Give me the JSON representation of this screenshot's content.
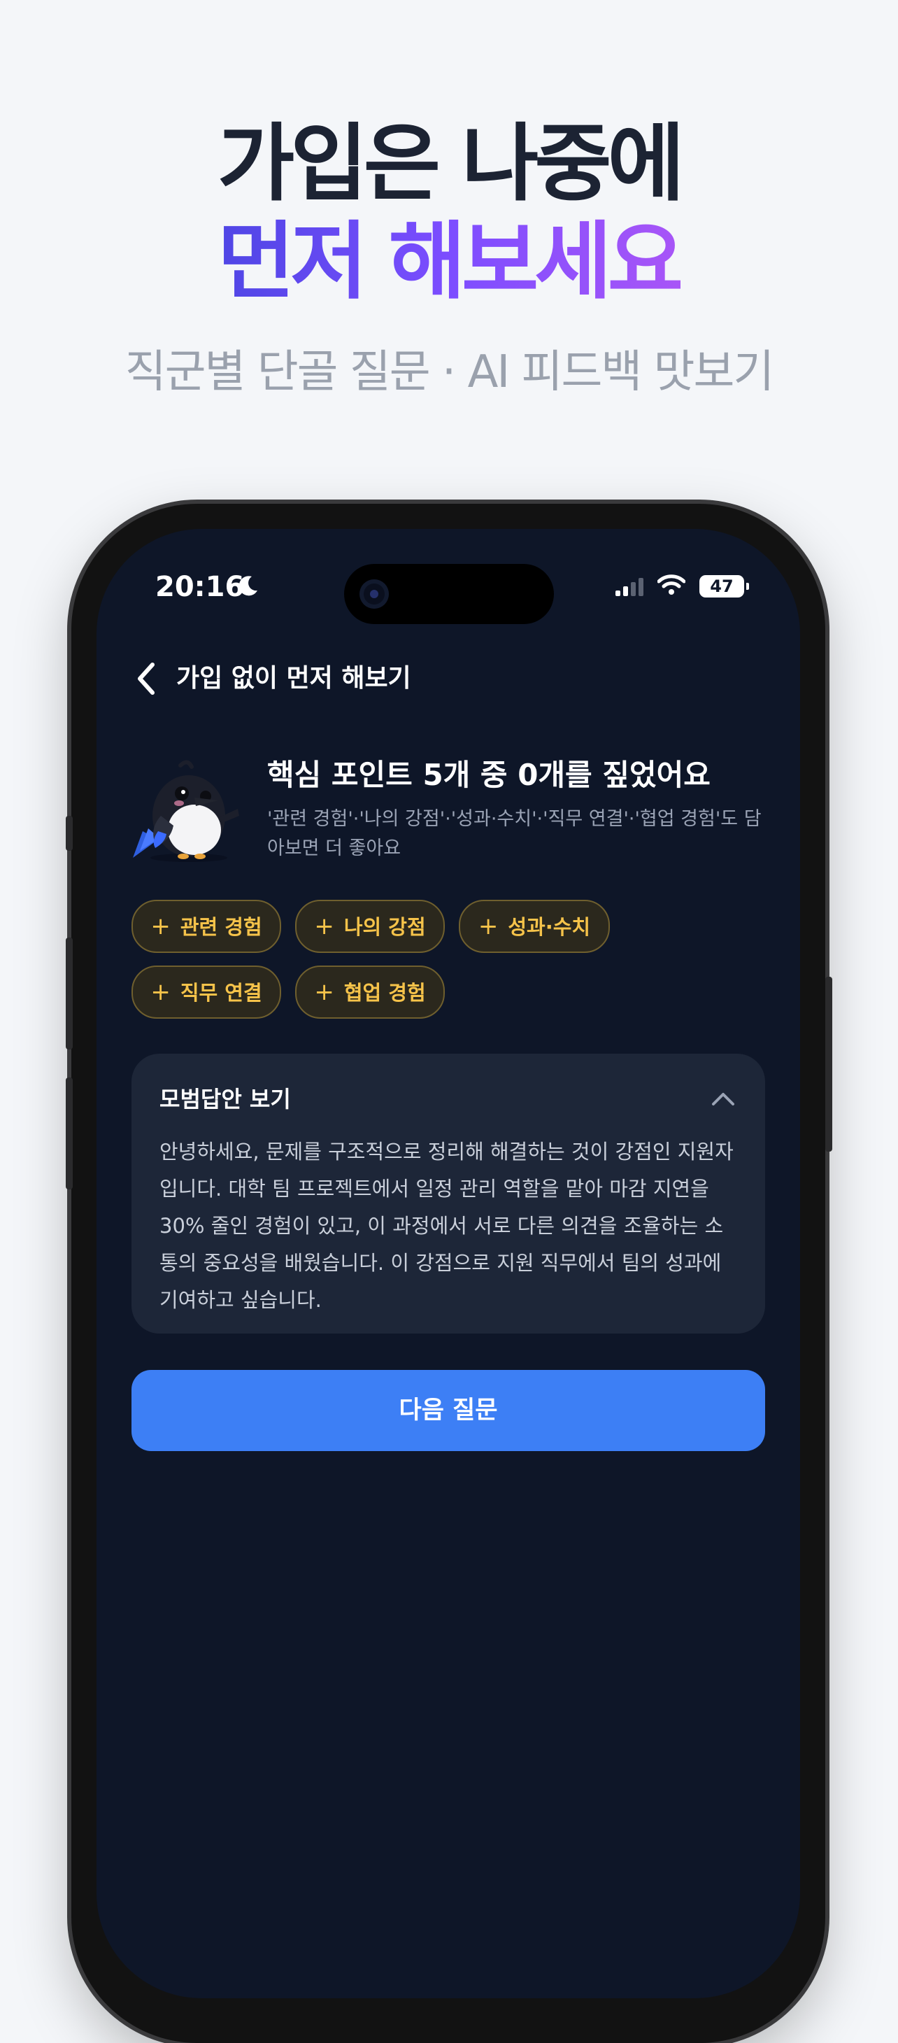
{
  "hero": {
    "line1": "가입은 나중에",
    "line2": "먼저 해보세요",
    "subtitle": "직군별 단골 질문 · AI 피드백 맛보기"
  },
  "status_bar": {
    "time": "20:16",
    "battery": "47"
  },
  "nav": {
    "title": "가입 없이 먼저 해보기"
  },
  "coach": {
    "title": "핵심 포인트 5개 중 0개를 짚었어요",
    "description": "'관련 경험'·'나의 강점'·'성과·수치'·'직무 연결'·'협업 경험'도 담아보면 더 좋아요"
  },
  "chips": [
    {
      "plus": "+",
      "label": "관련 경험"
    },
    {
      "plus": "+",
      "label": "나의 강점"
    },
    {
      "plus": "+",
      "label": "성과·수치"
    },
    {
      "plus": "+",
      "label": "직무 연결"
    },
    {
      "plus": "+",
      "label": "협업 경험"
    }
  ],
  "model_answer": {
    "title": "모범답안 보기",
    "body": "안녕하세요, 문제를 구조적으로 정리해 해결하는 것이 강점인 지원자입니다. 대학 팀 프로젝트에서 일정 관리 역할을 맡아 마감 지연을 30% 줄인 경험이 있고, 이 과정에서 서로 다른 의견을 조율하는 소통의 중요성을 배웠습니다. 이 강점으로 지원 직무에서 팀의 성과에 기여하고 싶습니다."
  },
  "cta": {
    "label": "다음 질문"
  },
  "icons": {
    "back": "chevron-left-icon",
    "collapse": "chevron-up-icon",
    "moon": "moon-icon",
    "signal": "signal-icon",
    "wifi": "wifi-icon"
  },
  "colors": {
    "screen_bg": "#0e1628",
    "accent_blue": "#3d7ff5",
    "chip_text": "#f6c34a",
    "gradient_start": "#4f46e5",
    "gradient_end": "#a855f7"
  }
}
